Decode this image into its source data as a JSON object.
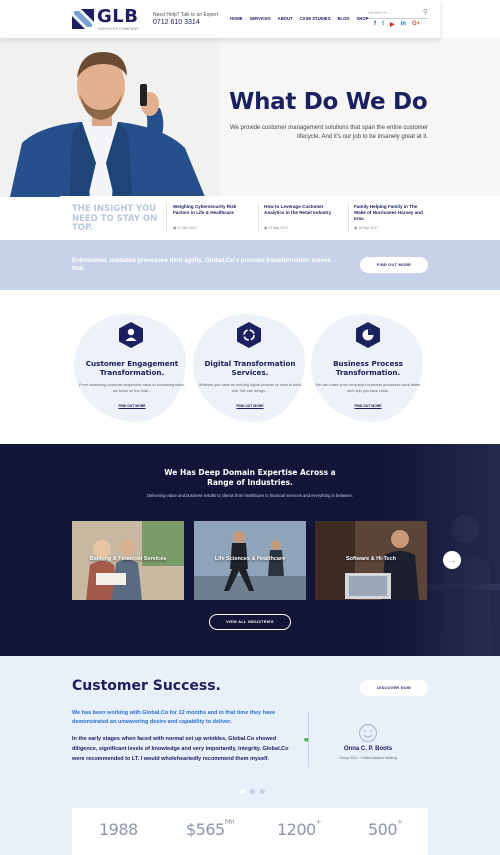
{
  "header": {
    "logo_text": "GLB",
    "logo_sub": "SERVICES COMPANY",
    "help_label": "Need Help? Talk to an Expert",
    "help_phone": "0712 610 3314",
    "nav": [
      "HOME",
      "SERVICES",
      "ABOUT",
      "CASE STUDIES",
      "BLOG",
      "SHOP"
    ],
    "search_placeholder": "SEARCH...",
    "social": [
      {
        "icon": "facebook-icon",
        "glyph": "f",
        "color": "#3b5998"
      },
      {
        "icon": "twitter-icon",
        "glyph": "t",
        "color": "#1da1f2"
      },
      {
        "icon": "youtube-icon",
        "glyph": "▶",
        "color": "#e52d27"
      },
      {
        "icon": "linkedin-icon",
        "glyph": "in",
        "color": "#0e76a8"
      },
      {
        "icon": "google-plus-icon",
        "glyph": "G+",
        "color": "#dd4b39"
      }
    ]
  },
  "hero": {
    "title": "What Do We Do",
    "subtitle": "We provide customer management solutions that span the entire customer lifecycle. And it's our job to be insanely great at it."
  },
  "news": {
    "heading": "THE INSIGHT YOU NEED TO STAY ON TOP.",
    "items": [
      {
        "title": "Weighing Cybersecurity Risk Factors in Life & Healthcare",
        "date": "07 Nov 2017"
      },
      {
        "title": "How to Leverage Customer Analytics in the Retail Industry",
        "date": "29 Sep 2017"
      },
      {
        "title": "Family Helping Family in The Wake of Hurricanes Harvey and Irma",
        "date": "26 Sep 2017"
      }
    ]
  },
  "cta": {
    "text": "Entrenched, outdated processes limit agility. Global.Co's process transformation solves that.",
    "button": "FIND OUT MORE"
  },
  "services": [
    {
      "icon": "user-icon",
      "title": "Customer Engagement Transformation.",
      "text": "From increasing customer acquisition rates to increasing sales, we focus on the total...",
      "link": "FIND OUT MORE"
    },
    {
      "icon": "cycle-icon",
      "title": "Digital Transformation Services.",
      "text": "Whether you have an existing digital process or want to build one, We can design...",
      "link": "FIND OUT MORE"
    },
    {
      "icon": "pie-chart-icon",
      "title": "Business Process Transformation.",
      "text": "We can make your company's business processes work better and help you save costs.",
      "link": "FIND OUT MORE"
    }
  ],
  "industries": {
    "title": "We Has Deep Domain Expertise Across a Range of Industries.",
    "subtitle": "Delivering value and business results to clients from healthcare to financial services and everything in between.",
    "cards": [
      "Banking & Financial Services",
      "Life Sciences & Healthcare",
      "Software & Hi-Tech"
    ],
    "button": "VIEW ALL INDUSTRIES",
    "next_icon": "→"
  },
  "success": {
    "title": "Customer Success.",
    "button": "DISCOVER NOW",
    "quote_highlight": "We has been working with Global.Co for 12 months and in that time they have demonstrated an unwavering desire and capability to deliver.",
    "quote_body": "In the early stages when faced with normal set up wrinkles, Global.Co showed diligence, significant levels of knowledge and very importantly, integrity. Global.Co were recommended to LT. I would wholeheartedly recommend them myself.",
    "name": "Onna C. P. Boots",
    "role": "Group CEO - Cobbs Aviation Holding"
  },
  "stats": [
    {
      "value": "1988",
      "suffix": ""
    },
    {
      "value": "$565",
      "suffix": "Mn"
    },
    {
      "value": "1200",
      "suffix": "+"
    },
    {
      "value": "500",
      "suffix": "+"
    }
  ]
}
